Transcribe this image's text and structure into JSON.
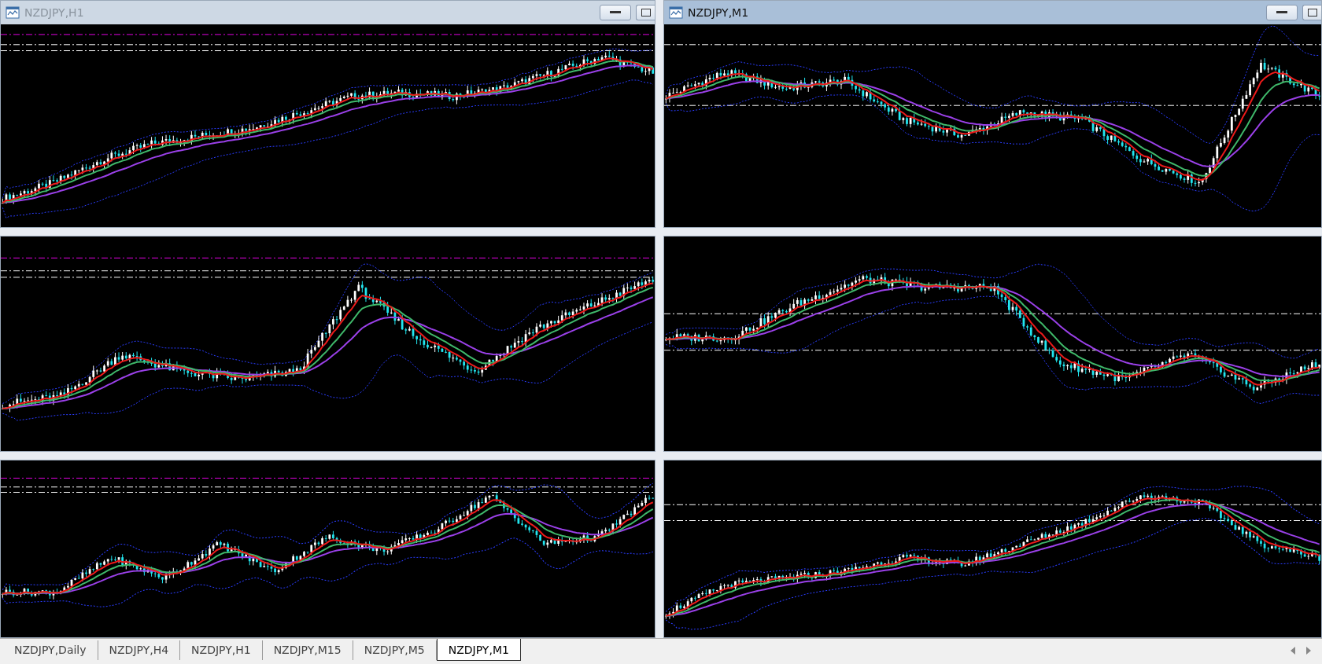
{
  "panels": [
    {
      "kind": "window",
      "title": "NZDJPY,H1",
      "active": false
    },
    {
      "kind": "window",
      "title": "NZDJPY,M1",
      "active": true
    },
    {
      "kind": "chart"
    },
    {
      "kind": "chart"
    },
    {
      "kind": "chart"
    },
    {
      "kind": "chart"
    }
  ],
  "tabs": [
    {
      "label": "NZDJPY,Daily",
      "selected": false
    },
    {
      "label": "NZDJPY,H4",
      "selected": false
    },
    {
      "label": "NZDJPY,H1",
      "selected": false
    },
    {
      "label": "NZDJPY,M15",
      "selected": false
    },
    {
      "label": "NZDJPY,M5",
      "selected": false
    },
    {
      "label": "NZDJPY,M1",
      "selected": true
    }
  ]
}
